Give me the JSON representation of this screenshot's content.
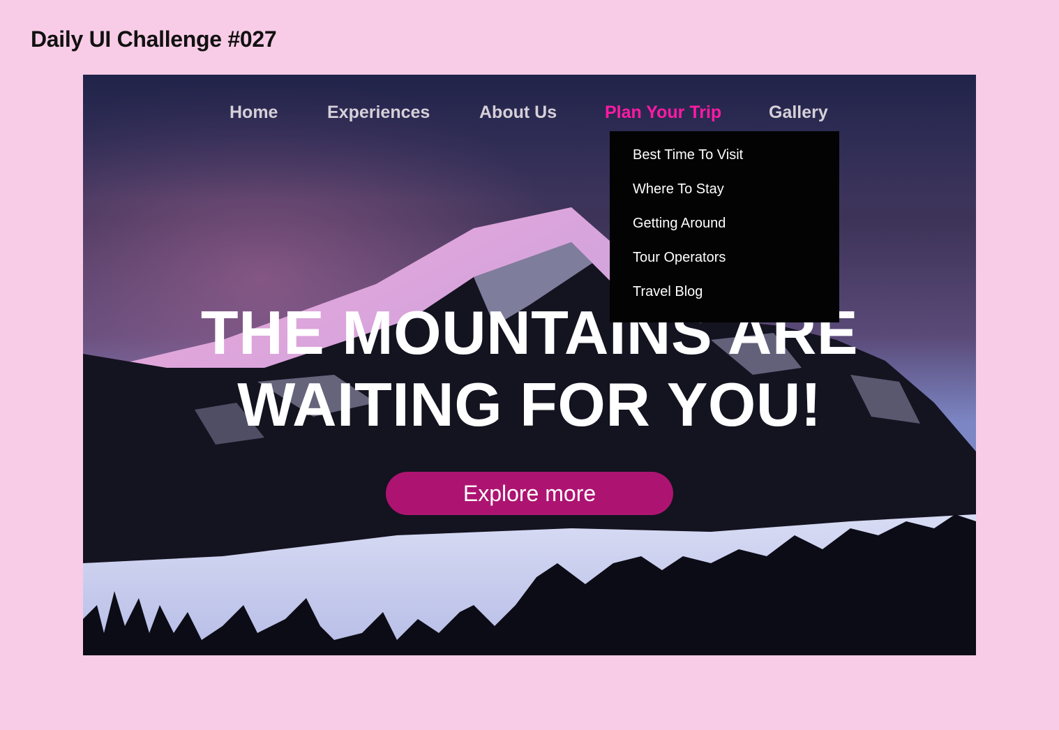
{
  "page": {
    "title": "Daily UI Challenge #027"
  },
  "nav": {
    "items": [
      {
        "label": "Home"
      },
      {
        "label": "Experiences"
      },
      {
        "label": "About Us"
      },
      {
        "label": "Plan Your Trip",
        "active": true
      },
      {
        "label": "Gallery"
      }
    ]
  },
  "dropdown": {
    "items": [
      {
        "label": "Best Time To Visit"
      },
      {
        "label": "Where To Stay"
      },
      {
        "label": "Getting Around"
      },
      {
        "label": "Tour Operators"
      },
      {
        "label": "Travel Blog"
      }
    ]
  },
  "hero": {
    "line1": "THE MOUNTAINS ARE",
    "line2": "WAITING FOR YOU!",
    "cta_label": "Explore more",
    "background_image": "snowy-mountain-landscape"
  },
  "colors": {
    "page_bg": "#f8cce6",
    "accent": "#ff1aa3",
    "nav_text": "#d6d0d8",
    "dropdown_bg": "#030304",
    "cta_bg": "#d81488"
  }
}
